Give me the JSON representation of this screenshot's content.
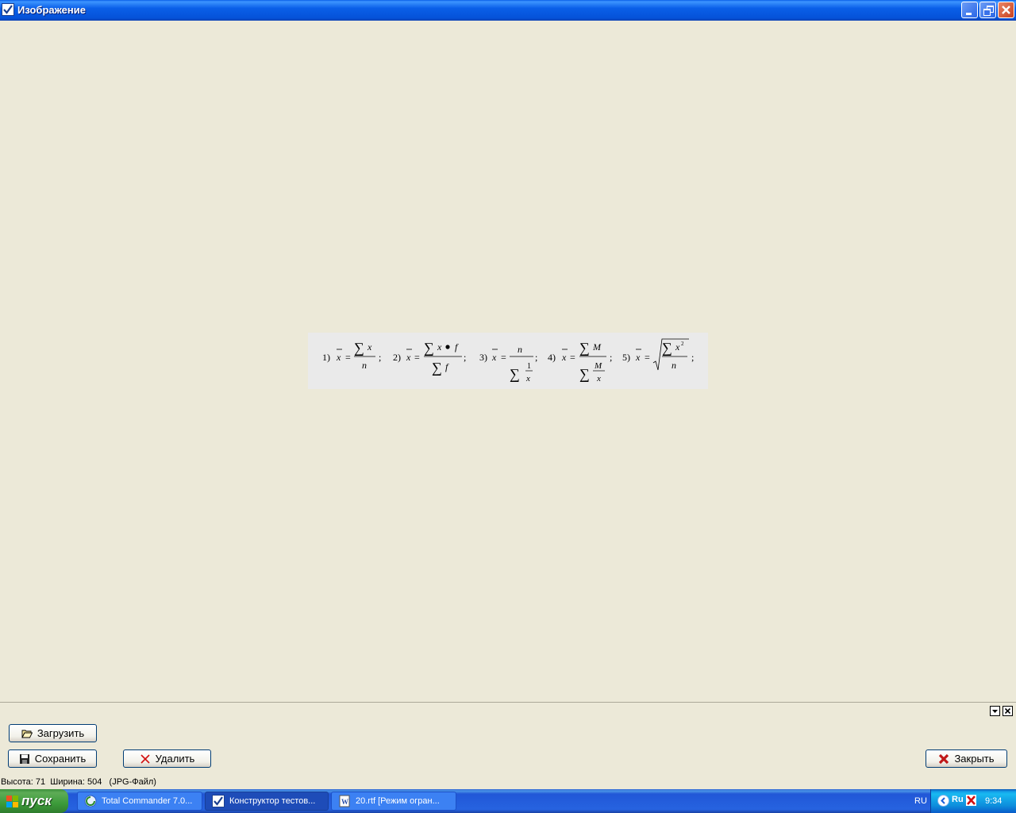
{
  "window": {
    "title": "Изображение",
    "controls": {
      "minimize": "minimize",
      "restore": "restore",
      "close": "close"
    }
  },
  "image": {
    "formula_labels": [
      "1)",
      "2)",
      "3)",
      "4)",
      "5)"
    ],
    "separator": ";"
  },
  "panel": {
    "load_label": "Загрузить",
    "save_label": "Сохранить",
    "delete_label": "Удалить",
    "close_label": "Закрыть"
  },
  "status": {
    "text": "Высота: 71  Ширина: 504   (JPG-Файл)"
  },
  "taskbar": {
    "start_label": "пуск",
    "tasks": [
      {
        "label": "Total Commander 7.0...",
        "icon": "total-commander-icon",
        "active": false
      },
      {
        "label": "Конструктор тестов...",
        "icon": "checkbox-app-icon",
        "active": true
      },
      {
        "label": "20.rtf [Режим огран...",
        "icon": "word-document-icon",
        "active": false
      }
    ],
    "language": "RU",
    "tray_lang": "Ru",
    "clock": "9:34"
  },
  "colors": {
    "background": "#ECE9D8",
    "titlebar": "#0A5FE8",
    "taskbar": "#2663E0",
    "start": "#3C9B3A",
    "close_red": "#C9421F"
  }
}
